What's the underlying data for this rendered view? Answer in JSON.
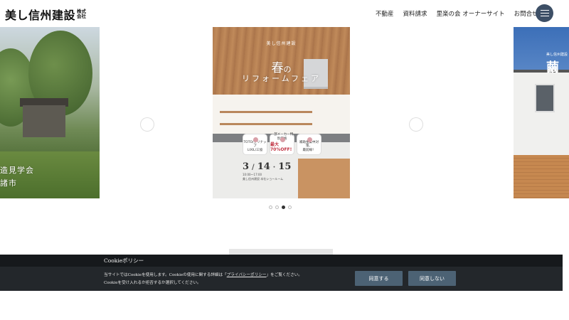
{
  "header": {
    "logo_main": "美し信州建設",
    "logo_sub1": "株式",
    "logo_sub2": "会社",
    "nav": [
      "不動産",
      "資料請求",
      "里楽の会 オーナーサイト",
      "お問合せ"
    ],
    "menu_icon": "hamburger-icon"
  },
  "carousel": {
    "left_slide": {
      "caption_line1": "造見学会",
      "caption_line2": "諸市"
    },
    "center_slide": {
      "subtitle": "美し信州建設",
      "spring": "春",
      "no": "の",
      "title": "リフォームフェア",
      "badges": [
        {
          "text1": "TOTO/クリナップ",
          "text2": "LIXIL/三協",
          "strong": ""
        },
        {
          "text1": "一部メーカー特別価格",
          "text2": "",
          "strong": "最大70%OFF!"
        },
        {
          "text1": "補助金集中対策、",
          "text2": "最前線！",
          "strong": ""
        }
      ],
      "date_month": "3",
      "date_day1": "14",
      "date_day2": "15",
      "date_small1": "10:00〜17:00",
      "date_small2": "美し信州建設 本社ショールーム"
    },
    "right_slide": {
      "subtitle": "美し信州建設",
      "char": "繭"
    },
    "dots": [
      false,
      false,
      true,
      false
    ]
  },
  "cookie": {
    "title": "Cookieポリシー",
    "line1_prefix": "当サイトではCookieを使用します。Cookieの使用に関する詳細は「",
    "line1_link": "プライバシーポリシー",
    "line1_suffix": "」をご覧ください。",
    "line2": "Cookieを受け入れるか拒否するか選択してください。",
    "agree_label": "同意する",
    "disagree_label": "同意しない"
  },
  "colors": {
    "menu_button": "#3d4f66",
    "cookie_bg": "#23272b",
    "cookie_button": "#4c6274"
  }
}
